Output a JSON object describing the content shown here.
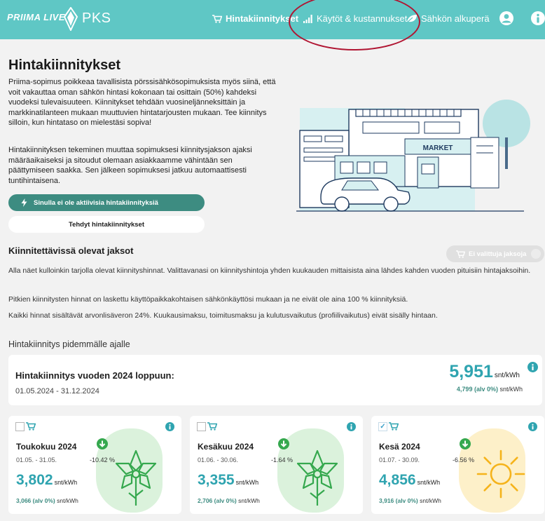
{
  "header": {
    "brand": "PRIIMA LIVE",
    "company": "PKS",
    "nav": [
      {
        "label": "Hintakiinnitykset",
        "active": true
      },
      {
        "label": "Käytöt & kustannukset",
        "active": false
      },
      {
        "label": "Sähkön alkuperä",
        "active": false
      }
    ]
  },
  "hero": {
    "title": "Hintakiinnitykset",
    "paragraph1": "Priima-sopimus poikkeaa tavallisista pörssisähkösopimuksista myös siinä, että voit vakauttaa oman sähkön hintasi kokonaan tai osittain (50%) kahdeksi vuodeksi tulevaisuuteen. Kiinnitykset tehdään vuosineljänneksittäin ja markkinatilanteen mukaan muuttuvien hintatarjousten mukaan. Tee kiinnitys silloin, kun hintataso on mielestäsi sopiva!",
    "paragraph2": "Hintakiinnityksen tekeminen muuttaa sopimuksesi kiinnitysjakson ajaksi määräaikaiseksi ja sitoudut olemaan asiakkaamme vähintään sen päättymiseen saakka. Sen jälkeen sopimuksesi jatkuu automaattisesti tuntihintaisena.",
    "status": "Sinulla ei ole aktiivisia hintakiinnityksiä",
    "done_button": "Tehdyt hintakiinnitykset",
    "illustration_sign": "MARKET"
  },
  "periods": {
    "title": "Kiinnitettävissä olevat jaksot",
    "cart_button": "Ei valittuja jaksoja",
    "info1": "Alla näet kulloinkin tarjolla olevat kiinnityshinnat. Valittavanasi on kiinnityshintoja yhden kuukauden mittaisista aina lähdes kahden vuoden pituisiin hintajaksoihin.",
    "info2": "Pitkien kiinnitysten hinnat on laskettu käyttöpaikkakohtaisen sähkönkäyttösi mukaan ja ne eivät ole aina 100 % kiinnityksiä.",
    "info3": "Kaikki hinnat sisältävät arvonlisäveron 24%. Kuukausimaksu, toimitusmaksu ja kulutusvaikutus (profiilivaikutus) eivät sisälly hintaan.",
    "long_title": "Hintakiinnitys pidemmälle ajalle"
  },
  "year_offer": {
    "title": "Hintakiinnitys vuoden 2024 loppuun:",
    "dates": "01.05.2024 - 31.12.2024",
    "price": "5,951",
    "unit": "snt/kWh",
    "vat_label": "4,799 (alv 0%)",
    "vat_unit": "snt/kWh"
  },
  "months": [
    {
      "title": "Toukokuu 2024",
      "dates": "01.05. - 31.05.",
      "change": "-10.42 %",
      "price": "3,802",
      "unit": "snt/kWh",
      "vat_label": "3,066 (alv 0%)",
      "vat_unit": "snt/kWh",
      "checked": false,
      "icon": "flower-icon"
    },
    {
      "title": "Kesäkuu 2024",
      "dates": "01.06. - 30.06.",
      "change": "-1.64 %",
      "price": "3,355",
      "unit": "snt/kWh",
      "vat_label": "2,706 (alv 0%)",
      "vat_unit": "snt/kWh",
      "checked": false,
      "icon": "flower-icon"
    },
    {
      "title": "Kesä 2024",
      "dates": "01.07. - 30.09.",
      "change": "-6.56 %",
      "price": "4,856",
      "unit": "snt/kWh",
      "vat_label": "3,916 (alv 0%)",
      "vat_unit": "snt/kWh",
      "checked": true,
      "icon": "sun-icon"
    }
  ],
  "colors": {
    "header": "#5fc7c5",
    "price": "#2fa4b0",
    "accent_green": "#3d8c81",
    "annotation_circle": "#b01532"
  }
}
